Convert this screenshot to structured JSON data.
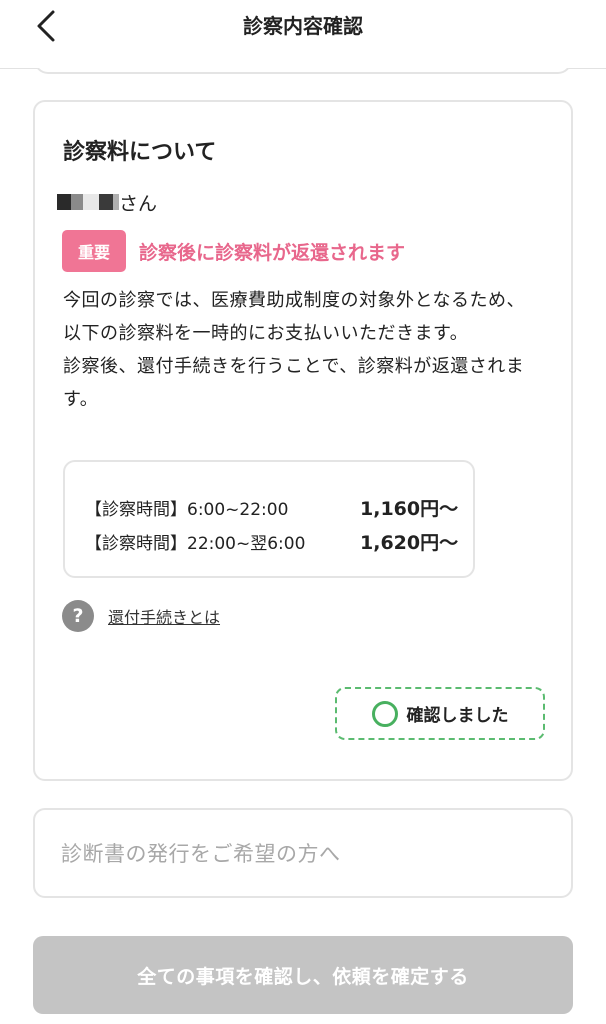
{
  "header": {
    "title": "診察内容確認",
    "back_icon": "chevron-left-icon"
  },
  "fee_section": {
    "title": "診察料について",
    "patient_suffix": "さん",
    "badge": "重要",
    "important_message": "診察後に診察料が返還されます",
    "description_lines": [
      "今回の診察では、医療費助成制度の対象外となるため、以下の診察料を一時的にお支払いいただきます。",
      "診察後、還付手続きを行うことで、診察料が返還されます。"
    ],
    "fees": [
      {
        "label": "【診察時間】6:00~22:00",
        "price": "1,160円〜"
      },
      {
        "label": "【診察時間】22:00~翌6:00",
        "price": "1,620円〜"
      }
    ],
    "help_icon": "?",
    "help_link": "還付手続きとは",
    "confirm_label": "確認しました"
  },
  "diagnosis_section": {
    "label": "診断書の発行をご希望の方へ"
  },
  "submit": {
    "label": "全ての事項を確認し、依頼を確定する",
    "enabled": false
  },
  "colors": {
    "accent_pink": "#f07595",
    "important_text": "#e8678c",
    "confirm_green": "#48b05f",
    "disabled_gray": "#c4c4c4",
    "border": "#e4e4e4"
  }
}
